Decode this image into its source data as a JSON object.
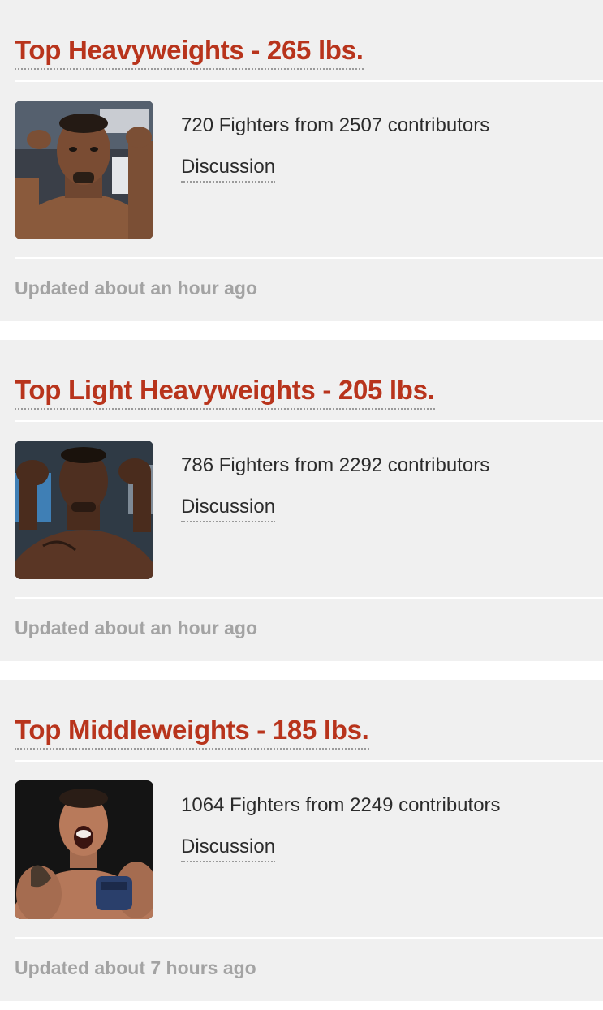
{
  "rankings": [
    {
      "title": "Top Heavyweights - 265 lbs.",
      "stats": "720 Fighters from 2507 contributors",
      "discussion_label": "Discussion",
      "updated": "Updated about an hour ago",
      "image": "fighter-photo"
    },
    {
      "title": "Top Light Heavyweights - 205 lbs.",
      "stats": "786 Fighters from 2292 contributors",
      "discussion_label": "Discussion",
      "updated": "Updated about an hour ago",
      "image": "fighter-photo"
    },
    {
      "title": "Top Middleweights - 185 lbs.",
      "stats": "1064 Fighters from 2249 contributors",
      "discussion_label": "Discussion",
      "updated": "Updated about 7 hours ago",
      "image": "fighter-photo"
    }
  ],
  "colors": {
    "title": "#b8341c",
    "card_background": "#f0f0f0",
    "page_background": "#ffffff",
    "updated_text": "#a3a3a3",
    "body_text": "#2b2b2b"
  }
}
